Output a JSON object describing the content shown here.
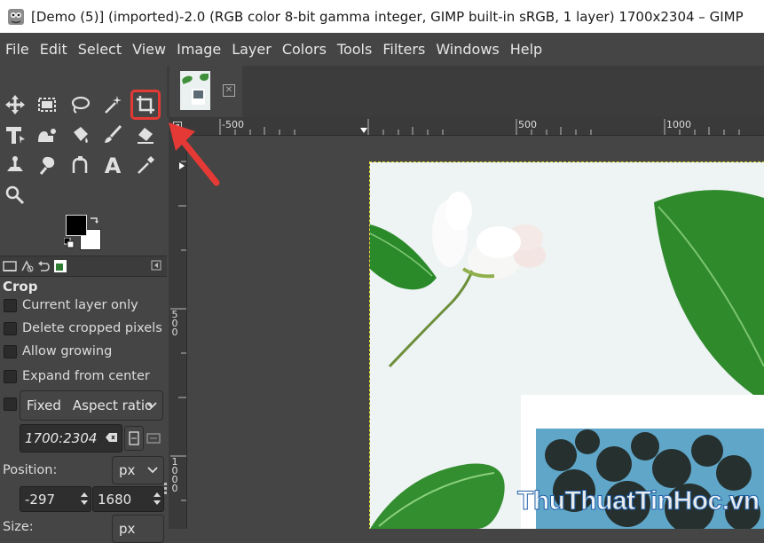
{
  "window": {
    "title": "[Demo (5)] (imported)-2.0 (RGB color 8-bit gamma integer, GIMP built-in sRGB, 1 layer) 1700x2304 – GIMP"
  },
  "menu": [
    "File",
    "Edit",
    "Select",
    "View",
    "Image",
    "Layer",
    "Colors",
    "Tools",
    "Filters",
    "Windows",
    "Help"
  ],
  "tools": [
    {
      "icon": "move-icon"
    },
    {
      "icon": "rect-select-icon"
    },
    {
      "icon": "free-select-icon"
    },
    {
      "icon": "fuzzy-select-icon"
    },
    {
      "icon": "crop-icon",
      "active": true
    },
    {
      "icon": "unified-transform-icon"
    },
    {
      "icon": "warp-transform-icon"
    },
    {
      "icon": "bucket-fill-icon"
    },
    {
      "icon": "paintbrush-icon"
    },
    {
      "icon": "eraser-icon"
    },
    {
      "icon": "clone-icon"
    },
    {
      "icon": "smudge-icon"
    },
    {
      "icon": "paths-icon"
    },
    {
      "icon": "text-icon"
    },
    {
      "icon": "color-picker-icon"
    },
    {
      "icon": "zoom-icon"
    }
  ],
  "accent": "#e53935",
  "tool_options": {
    "title": "Crop",
    "current_layer_only": "Current layer only",
    "delete_cropped": "Delete cropped pixels",
    "allow_growing": "Allow growing",
    "expand_from_center": "Expand from center",
    "fixed_label": "Fixed",
    "fixed_value": "Aspect ratio",
    "ratio_value": "1700:2304",
    "position_label": "Position:",
    "position_unit": "px",
    "position_x": "-297",
    "position_y": "1680",
    "size_label": "Size:",
    "size_unit": "px"
  },
  "ruler": {
    "h_labels": [
      "-500",
      "500",
      "1000"
    ],
    "v_labels": [
      "500",
      "1000"
    ]
  },
  "watermark": "ThuThuatTinHoc.vn"
}
